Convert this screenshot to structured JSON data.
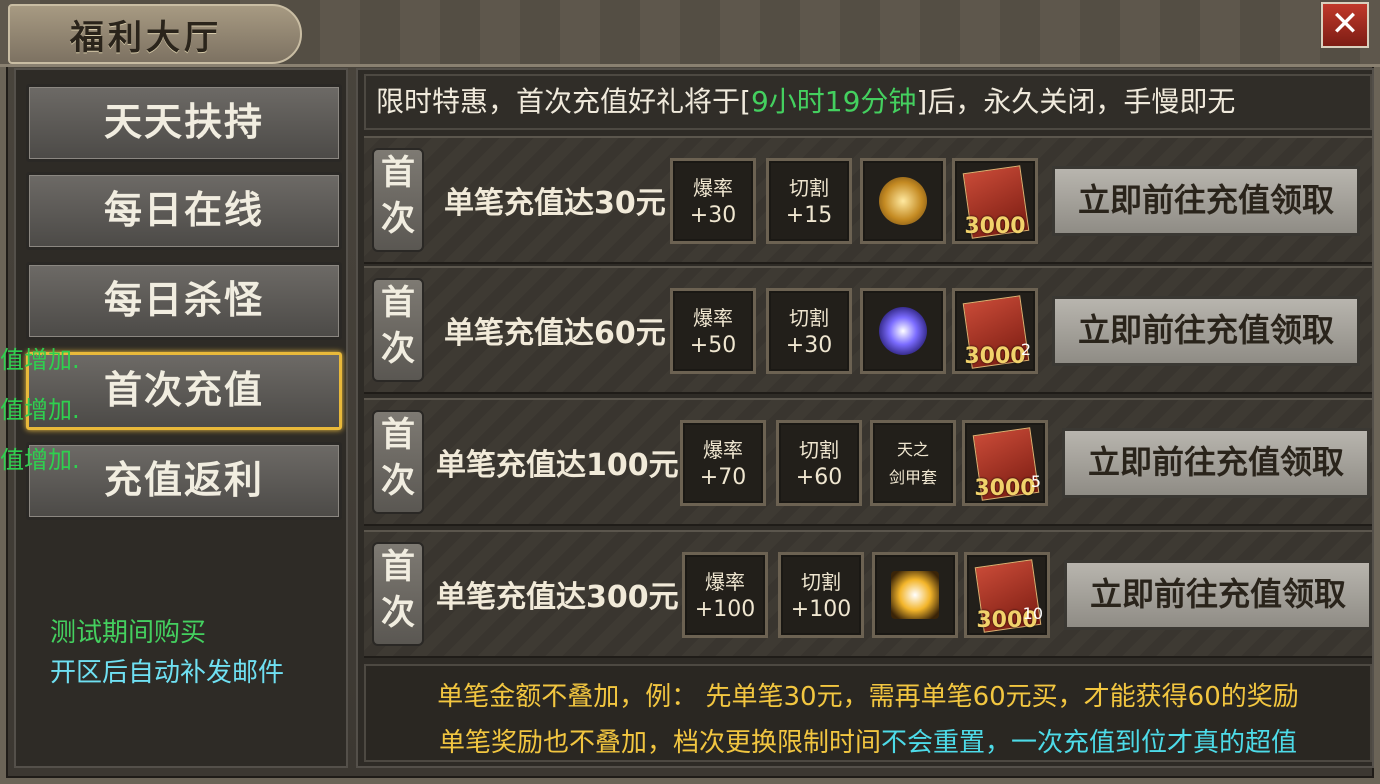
{
  "window": {
    "title": "福利大厅",
    "close_label": "✕"
  },
  "nav": {
    "items": [
      {
        "label": "天天扶持"
      },
      {
        "label": "每日在线"
      },
      {
        "label": "每日杀怪"
      },
      {
        "label": "首次充值",
        "active": true
      },
      {
        "label": "充值返利"
      }
    ]
  },
  "side_overlay": [
    "值增加.",
    "值增加.",
    "值增加."
  ],
  "left_notice": {
    "line1": "测试期间购买",
    "line2": "开区后自动补发邮件"
  },
  "banner": {
    "prefix": "限时特惠，首次充值好礼将于[",
    "timer": "9小时19分钟",
    "suffix": "]后，永久关闭，手慢即无"
  },
  "rows": [
    {
      "badge": "首次",
      "label": "单笔充值达30元",
      "items": [
        {
          "name": "爆率",
          "value": "+30"
        },
        {
          "name": "切割",
          "value": "+15"
        }
      ],
      "reward_icon": "crown-icon",
      "book_amount": "3000",
      "book_count": "",
      "button": "立即前往充值领取"
    },
    {
      "badge": "首次",
      "label": "单笔充值达60元",
      "items": [
        {
          "name": "爆率",
          "value": "+50"
        },
        {
          "name": "切割",
          "value": "+30"
        }
      ],
      "reward_icon": "orb-icon",
      "book_amount": "3000",
      "book_count": "2",
      "button": "立即前往充值领取"
    },
    {
      "badge": "首次",
      "label": "单笔充值达100元",
      "items": [
        {
          "name": "爆率",
          "value": "+70"
        },
        {
          "name": "切割",
          "value": "+60"
        }
      ],
      "reward_item": {
        "line1": "天之",
        "line2": "剑甲套"
      },
      "book_amount": "3000",
      "book_count": "5",
      "button": "立即前往充值领取"
    },
    {
      "badge": "首次",
      "label": "单笔充值达300元",
      "items": [
        {
          "name": "爆率",
          "value": "+100"
        },
        {
          "name": "切割",
          "value": "+100"
        }
      ],
      "reward_icon": "glow-box-icon",
      "book_amount": "3000",
      "book_count": "10",
      "button": "立即前往充值领取"
    }
  ],
  "footer": {
    "line1": "单笔金额不叠加，例：  先单笔30元，需再单笔60元买，才能获得60的奖励",
    "line2_a": "单笔奖励也不叠加，档次更换限制时间",
    "line2_b": "不会重置",
    "line2_c": "，一次充值到位才真的超值"
  },
  "colors": {
    "accent_gold": "#e9b93a",
    "text_green": "#44d05f",
    "text_cyan": "#4ddbe8",
    "footer_gold": "#f2c640"
  }
}
